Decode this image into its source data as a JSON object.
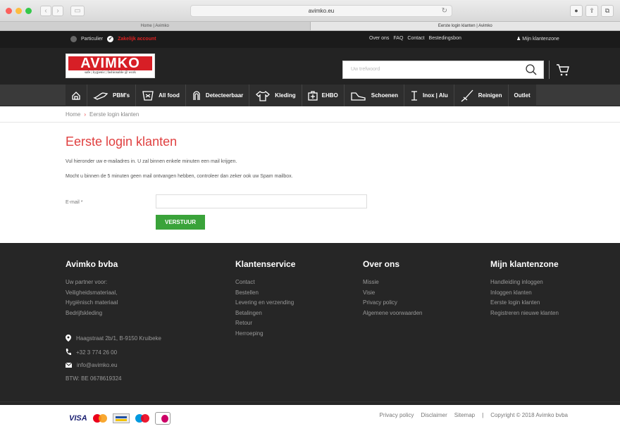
{
  "browser": {
    "url": "avimko.eu",
    "tabs": [
      "Home | Avimko",
      "Eerste login klanten | Avimko"
    ]
  },
  "topbar": {
    "particulier": "Particulier",
    "zakelijk": "Zakelijk account",
    "links": [
      "Over ons",
      "FAQ",
      "Contact",
      "Bestedingsbon"
    ],
    "klantenzone": "Mijn klantenzone"
  },
  "header": {
    "logo_text": "AVIMKO",
    "logo_tagline": "safe | hygienic | fashionable @ work",
    "search_placeholder": "Uw trefwoord"
  },
  "categories": [
    {
      "label": "",
      "icon": "home-icon"
    },
    {
      "label": "PBM's",
      "icon": "glove-icon"
    },
    {
      "label": "All food",
      "icon": "food-icon"
    },
    {
      "label": "Detecteerbaar",
      "icon": "detect-icon"
    },
    {
      "label": "Kleding",
      "icon": "shirt-icon"
    },
    {
      "label": "EHBO",
      "icon": "firstaid-icon"
    },
    {
      "label": "Schoenen",
      "icon": "shoe-icon"
    },
    {
      "label": "Inox | Alu",
      "icon": "inox-icon"
    },
    {
      "label": "Reinigen",
      "icon": "broom-icon"
    },
    {
      "label": "Outlet",
      "icon": ""
    }
  ],
  "breadcrumb": {
    "home": "Home",
    "sep": "›",
    "current": "Eerste login klanten"
  },
  "main": {
    "title": "Eerste login klanten",
    "line1": "Vul hieronder uw e-mailadres in. U zal binnen enkele minuten een mail krijgen.",
    "line2": "Mocht u binnen de 5 minuten geen mail ontvangen hebben, controleer dan zeker ook uw Spam mailbox.",
    "email_label": "E-mail *",
    "submit": "VERSTUUR"
  },
  "footer": {
    "col1": {
      "title": "Avimko bvba",
      "lines": [
        "Uw partner voor:",
        "Veiligheidsmateriaal,",
        "Hygiënisch materiaal",
        "Bedrijfskleding"
      ]
    },
    "col2": {
      "title": "Klantenservice",
      "lines": [
        "Contact",
        "Bestellen",
        "Levering en verzending",
        "Betalingen",
        "Retour",
        "Herroeping"
      ]
    },
    "col3": {
      "title": "Over ons",
      "lines": [
        "Missie",
        "Visie",
        "Privacy policy",
        "Algemene voorwaarden"
      ]
    },
    "col4": {
      "title": "Mijn klantenzone",
      "lines": [
        "Handleiding inloggen",
        "Inloggen klanten",
        "Eerste login klanten",
        "Registreren nieuwe klanten"
      ]
    },
    "address": "Haagstraat 2b/1, B-9150 Kruibeke",
    "phone": "+32 3 774 26 00",
    "email": "info@avimko.eu",
    "vat": "BTW: BE 0678619324",
    "bottom_links": [
      "Privacy policy",
      "Disclaimer",
      "Sitemap"
    ],
    "copyright": "Copyright © 2018 Avimko bvba"
  },
  "colors": {
    "accent": "#e04040",
    "button": "#3aa33a",
    "logo_red": "#d71f26"
  }
}
